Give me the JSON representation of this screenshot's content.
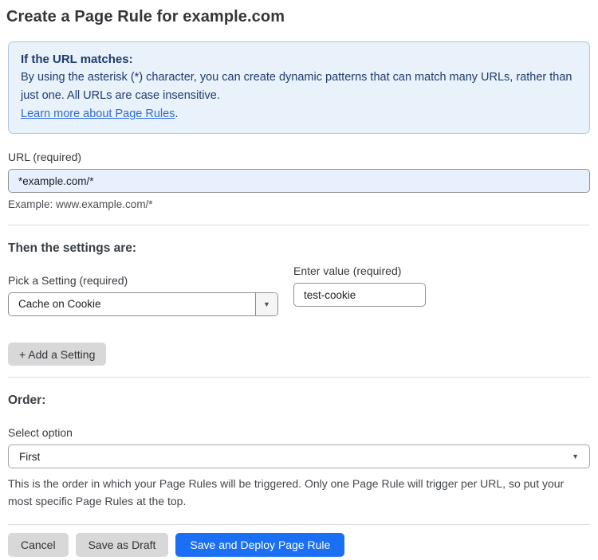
{
  "page": {
    "title": "Create a Page Rule for example.com"
  },
  "info_box": {
    "heading": "If the URL matches:",
    "body": "By using the asterisk (*) character, you can create dynamic patterns that can match many URLs, rather than just one. All URLs are case insensitive.",
    "link_label": "Learn more about Page Rules",
    "link_suffix": "."
  },
  "url_field": {
    "label": "URL (required)",
    "value": "*example.com/*",
    "helper": "Example: www.example.com/*"
  },
  "settings_section": {
    "heading": "Then the settings are:",
    "setting_label": "Pick a Setting (required)",
    "setting_value": "Cache on Cookie",
    "value_label": "Enter value (required)",
    "value_value": "test-cookie",
    "add_button_label": "+ Add a Setting"
  },
  "order_section": {
    "heading": "Order:",
    "select_label": "Select option",
    "select_value": "First",
    "helper": "This is the order in which your Page Rules will be triggered. Only one Page Rule will trigger per URL, so put your most specific Page Rules at the top."
  },
  "footer": {
    "cancel_label": "Cancel",
    "save_draft_label": "Save as Draft",
    "save_deploy_label": "Save and Deploy Page Rule"
  },
  "icons": {
    "dropdown_arrow": "▼"
  },
  "colors": {
    "info_bg": "#e9f1fb",
    "info_border": "#a9c9ea",
    "info_text": "#1e3c6e",
    "link": "#2e6bd9",
    "url_input_bg": "#e8f0fe",
    "primary_button": "#1a6ff5",
    "gray_button": "#d8d8d8"
  }
}
